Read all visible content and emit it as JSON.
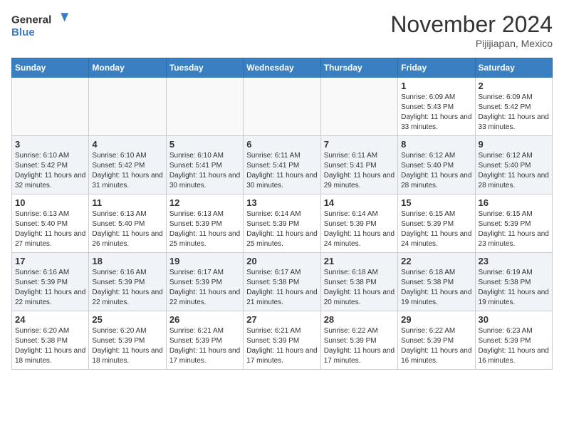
{
  "header": {
    "logo_general": "General",
    "logo_blue": "Blue",
    "month_title": "November 2024",
    "location": "Pijijiapan, Mexico"
  },
  "weekdays": [
    "Sunday",
    "Monday",
    "Tuesday",
    "Wednesday",
    "Thursday",
    "Friday",
    "Saturday"
  ],
  "weeks": [
    [
      {
        "day": "",
        "info": ""
      },
      {
        "day": "",
        "info": ""
      },
      {
        "day": "",
        "info": ""
      },
      {
        "day": "",
        "info": ""
      },
      {
        "day": "",
        "info": ""
      },
      {
        "day": "1",
        "info": "Sunrise: 6:09 AM\nSunset: 5:43 PM\nDaylight: 11 hours\nand 33 minutes."
      },
      {
        "day": "2",
        "info": "Sunrise: 6:09 AM\nSunset: 5:42 PM\nDaylight: 11 hours\nand 33 minutes."
      }
    ],
    [
      {
        "day": "3",
        "info": "Sunrise: 6:10 AM\nSunset: 5:42 PM\nDaylight: 11 hours\nand 32 minutes."
      },
      {
        "day": "4",
        "info": "Sunrise: 6:10 AM\nSunset: 5:42 PM\nDaylight: 11 hours\nand 31 minutes."
      },
      {
        "day": "5",
        "info": "Sunrise: 6:10 AM\nSunset: 5:41 PM\nDaylight: 11 hours\nand 30 minutes."
      },
      {
        "day": "6",
        "info": "Sunrise: 6:11 AM\nSunset: 5:41 PM\nDaylight: 11 hours\nand 30 minutes."
      },
      {
        "day": "7",
        "info": "Sunrise: 6:11 AM\nSunset: 5:41 PM\nDaylight: 11 hours\nand 29 minutes."
      },
      {
        "day": "8",
        "info": "Sunrise: 6:12 AM\nSunset: 5:40 PM\nDaylight: 11 hours\nand 28 minutes."
      },
      {
        "day": "9",
        "info": "Sunrise: 6:12 AM\nSunset: 5:40 PM\nDaylight: 11 hours\nand 28 minutes."
      }
    ],
    [
      {
        "day": "10",
        "info": "Sunrise: 6:13 AM\nSunset: 5:40 PM\nDaylight: 11 hours\nand 27 minutes."
      },
      {
        "day": "11",
        "info": "Sunrise: 6:13 AM\nSunset: 5:40 PM\nDaylight: 11 hours\nand 26 minutes."
      },
      {
        "day": "12",
        "info": "Sunrise: 6:13 AM\nSunset: 5:39 PM\nDaylight: 11 hours\nand 25 minutes."
      },
      {
        "day": "13",
        "info": "Sunrise: 6:14 AM\nSunset: 5:39 PM\nDaylight: 11 hours\nand 25 minutes."
      },
      {
        "day": "14",
        "info": "Sunrise: 6:14 AM\nSunset: 5:39 PM\nDaylight: 11 hours\nand 24 minutes."
      },
      {
        "day": "15",
        "info": "Sunrise: 6:15 AM\nSunset: 5:39 PM\nDaylight: 11 hours\nand 24 minutes."
      },
      {
        "day": "16",
        "info": "Sunrise: 6:15 AM\nSunset: 5:39 PM\nDaylight: 11 hours\nand 23 minutes."
      }
    ],
    [
      {
        "day": "17",
        "info": "Sunrise: 6:16 AM\nSunset: 5:39 PM\nDaylight: 11 hours\nand 22 minutes."
      },
      {
        "day": "18",
        "info": "Sunrise: 6:16 AM\nSunset: 5:39 PM\nDaylight: 11 hours\nand 22 minutes."
      },
      {
        "day": "19",
        "info": "Sunrise: 6:17 AM\nSunset: 5:39 PM\nDaylight: 11 hours\nand 22 minutes."
      },
      {
        "day": "20",
        "info": "Sunrise: 6:17 AM\nSunset: 5:38 PM\nDaylight: 11 hours\nand 21 minutes."
      },
      {
        "day": "21",
        "info": "Sunrise: 6:18 AM\nSunset: 5:38 PM\nDaylight: 11 hours\nand 20 minutes."
      },
      {
        "day": "22",
        "info": "Sunrise: 6:18 AM\nSunset: 5:38 PM\nDaylight: 11 hours\nand 19 minutes."
      },
      {
        "day": "23",
        "info": "Sunrise: 6:19 AM\nSunset: 5:38 PM\nDaylight: 11 hours\nand 19 minutes."
      }
    ],
    [
      {
        "day": "24",
        "info": "Sunrise: 6:20 AM\nSunset: 5:38 PM\nDaylight: 11 hours\nand 18 minutes."
      },
      {
        "day": "25",
        "info": "Sunrise: 6:20 AM\nSunset: 5:39 PM\nDaylight: 11 hours\nand 18 minutes."
      },
      {
        "day": "26",
        "info": "Sunrise: 6:21 AM\nSunset: 5:39 PM\nDaylight: 11 hours\nand 17 minutes."
      },
      {
        "day": "27",
        "info": "Sunrise: 6:21 AM\nSunset: 5:39 PM\nDaylight: 11 hours\nand 17 minutes."
      },
      {
        "day": "28",
        "info": "Sunrise: 6:22 AM\nSunset: 5:39 PM\nDaylight: 11 hours\nand 17 minutes."
      },
      {
        "day": "29",
        "info": "Sunrise: 6:22 AM\nSunset: 5:39 PM\nDaylight: 11 hours\nand 16 minutes."
      },
      {
        "day": "30",
        "info": "Sunrise: 6:23 AM\nSunset: 5:39 PM\nDaylight: 11 hours\nand 16 minutes."
      }
    ]
  ]
}
